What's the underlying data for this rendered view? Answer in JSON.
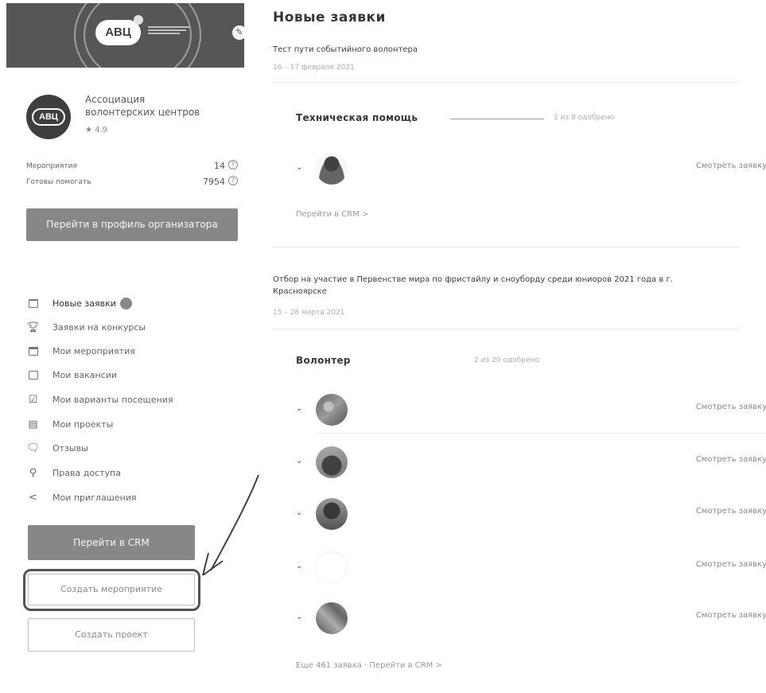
{
  "sidebar": {
    "banner_logo": "АВЦ",
    "org_logo": "АВЦ",
    "org_name_line1": "Ассоциация",
    "org_name_line2": "волонтерских центров",
    "org_rating": "★ 4.9",
    "stats": [
      {
        "label": "Мероприятия",
        "value": "14"
      },
      {
        "label": "Готовы помогать",
        "value": "7954"
      }
    ],
    "profile_button": "Перейти в профиль организатора",
    "menu": [
      {
        "label": "Новые заявки",
        "icon": "folder-icon"
      },
      {
        "label": "Заявки на конкурсы",
        "icon": "trophy-icon"
      },
      {
        "label": "Мои мероприятия",
        "icon": "calendar-icon"
      },
      {
        "label": "Мои вакансии",
        "icon": "briefcase-icon"
      },
      {
        "label": "Мои варианты посещения",
        "icon": "checkbox-icon"
      },
      {
        "label": "Мои проекты",
        "icon": "document-icon"
      },
      {
        "label": "Отзывы",
        "icon": "comment-icon"
      },
      {
        "label": "Права доступа",
        "icon": "key-icon"
      },
      {
        "label": "Мои приглашения",
        "icon": "share-icon"
      }
    ],
    "crm_button": "Перейти в CRM",
    "create_event_button": "Создать мероприятие",
    "create_project_button": "Создать проект"
  },
  "main": {
    "title": "Новые заявки",
    "events": [
      {
        "title": "Тест пути событийного волонтера",
        "date": "16 – 17 февраля 2021",
        "group": "Техническая помощь",
        "group_count": "1 из 8 одобрено",
        "crm_link": "Перейти в CRM >"
      },
      {
        "title_line1": "Отбор на участие в Первенстве мира по фристайлу и сноуборду среди юниоров 2021 года в г.",
        "title_line2": "Красноярске",
        "date": "15 – 28 марта 2021",
        "group": "Волонтер",
        "group_count": "2 из 20 одобрено",
        "more_link": "Еще 461 заявка · Перейти в CRM >"
      }
    ],
    "view_application": "Смотреть заявку"
  }
}
